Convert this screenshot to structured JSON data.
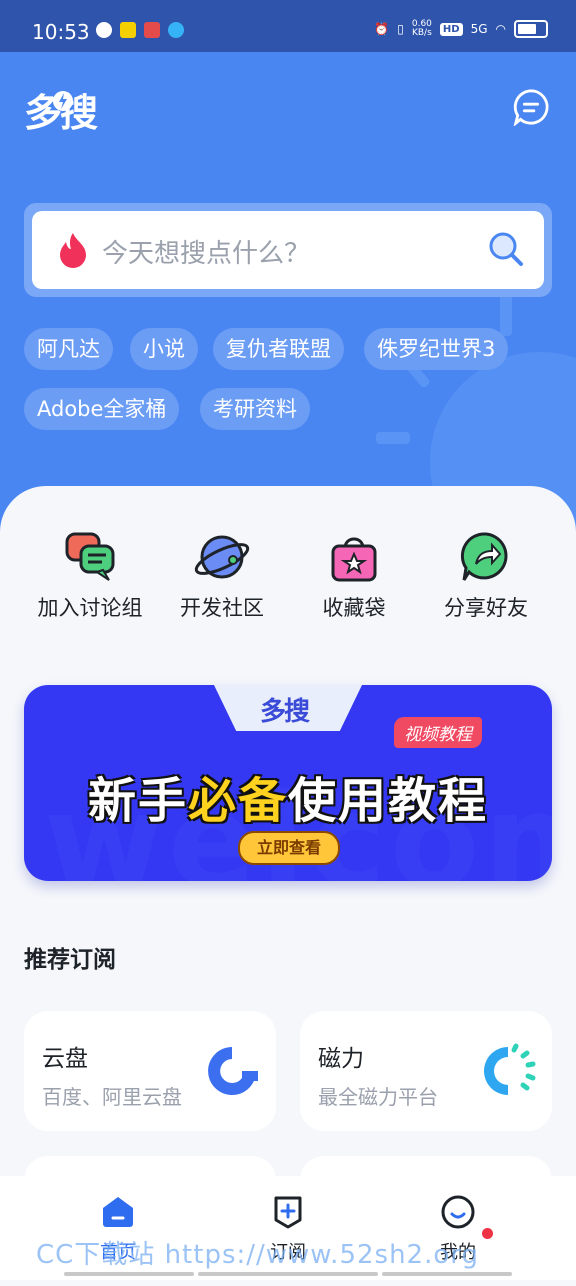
{
  "status_bar": {
    "time": "10:53",
    "net_speed_value": "0.60",
    "net_speed_unit": "KB/s",
    "hd": "HD",
    "network": "5G"
  },
  "header": {
    "logo_text": "多搜"
  },
  "search": {
    "placeholder": "今天想搜点什么？"
  },
  "hot_tags": [
    "阿凡达",
    "小说",
    "复仇者联盟",
    "侏罗纪世界3",
    "Adobe全家桶",
    "考研资料"
  ],
  "quick_actions": [
    {
      "label": "加入讨论组",
      "icon": "chat-bubbles-icon"
    },
    {
      "label": "开发社区",
      "icon": "planet-icon"
    },
    {
      "label": "收藏袋",
      "icon": "shopping-bag-icon"
    },
    {
      "label": "分享好友",
      "icon": "share-icon"
    }
  ],
  "banner": {
    "logo": "多搜",
    "badge": "视频教程",
    "title_part1": "新手",
    "title_highlight": "必备",
    "title_part2": "使用教程",
    "cta": "立即查看",
    "bg_word": "welcome"
  },
  "recommend": {
    "title": "推荐订阅",
    "cards": [
      {
        "title": "云盘",
        "subtitle": "百度、阿里云盘",
        "icon": "cloud-disk-icon"
      },
      {
        "title": "磁力",
        "subtitle": "最全磁力平台",
        "icon": "magnet-loading-icon"
      }
    ]
  },
  "bottom_nav": [
    {
      "label": "首页",
      "icon": "home-icon",
      "active": true
    },
    {
      "label": "订阅",
      "icon": "subscribe-icon",
      "active": false
    },
    {
      "label": "我的",
      "icon": "profile-icon",
      "active": false,
      "badge_dot": true
    }
  ],
  "watermark": "CC下载站 https://www.52sh2.org",
  "colors": {
    "primary": "#4a86f2",
    "active": "#2e6cf0",
    "banner": "#3438f3",
    "badge": "#f04a63"
  }
}
